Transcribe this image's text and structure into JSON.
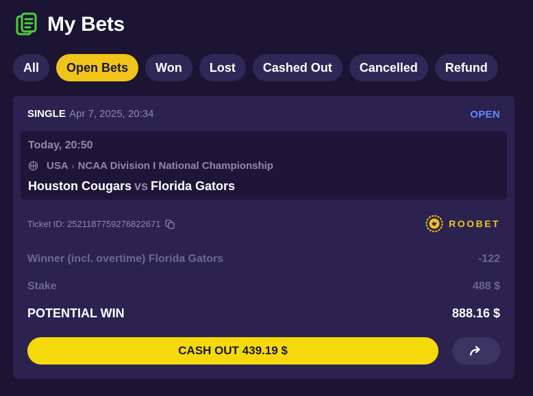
{
  "header": {
    "title": "My Bets",
    "icon": "bets-document-icon"
  },
  "filters": [
    {
      "label": "All",
      "active": false
    },
    {
      "label": "Open Bets",
      "active": true
    },
    {
      "label": "Won",
      "active": false
    },
    {
      "label": "Lost",
      "active": false
    },
    {
      "label": "Cashed Out",
      "active": false
    },
    {
      "label": "Cancelled",
      "active": false
    },
    {
      "label": "Refund",
      "active": false
    }
  ],
  "bet": {
    "type": "SINGLE",
    "placed_at": "Apr 7, 2025, 20:34",
    "status": "OPEN",
    "event": {
      "time": "Today, 20:50",
      "country": "USA",
      "league": "NCAA Division I National Championship",
      "home_team": "Houston Cougars",
      "vs": "vs",
      "away_team": "Florida Gators"
    },
    "ticket_id": "Ticket ID: 2521187759276822671",
    "brand": "ROOBET",
    "selection": "Winner (incl. overtime) Florida Gators",
    "odds": "-122",
    "stake_label": "Stake",
    "stake_value": "488 $",
    "potential_win_label": "POTENTIAL WIN",
    "potential_win_value": "888.16 $",
    "cashout_label": "CASH OUT 439.19 $"
  },
  "colors": {
    "background": "#1b1433",
    "card": "#2b2250",
    "accent_yellow": "#f0c419",
    "cashout_yellow": "#f5d90a",
    "status_blue": "#5b8dff",
    "icon_green": "#4cd137"
  }
}
